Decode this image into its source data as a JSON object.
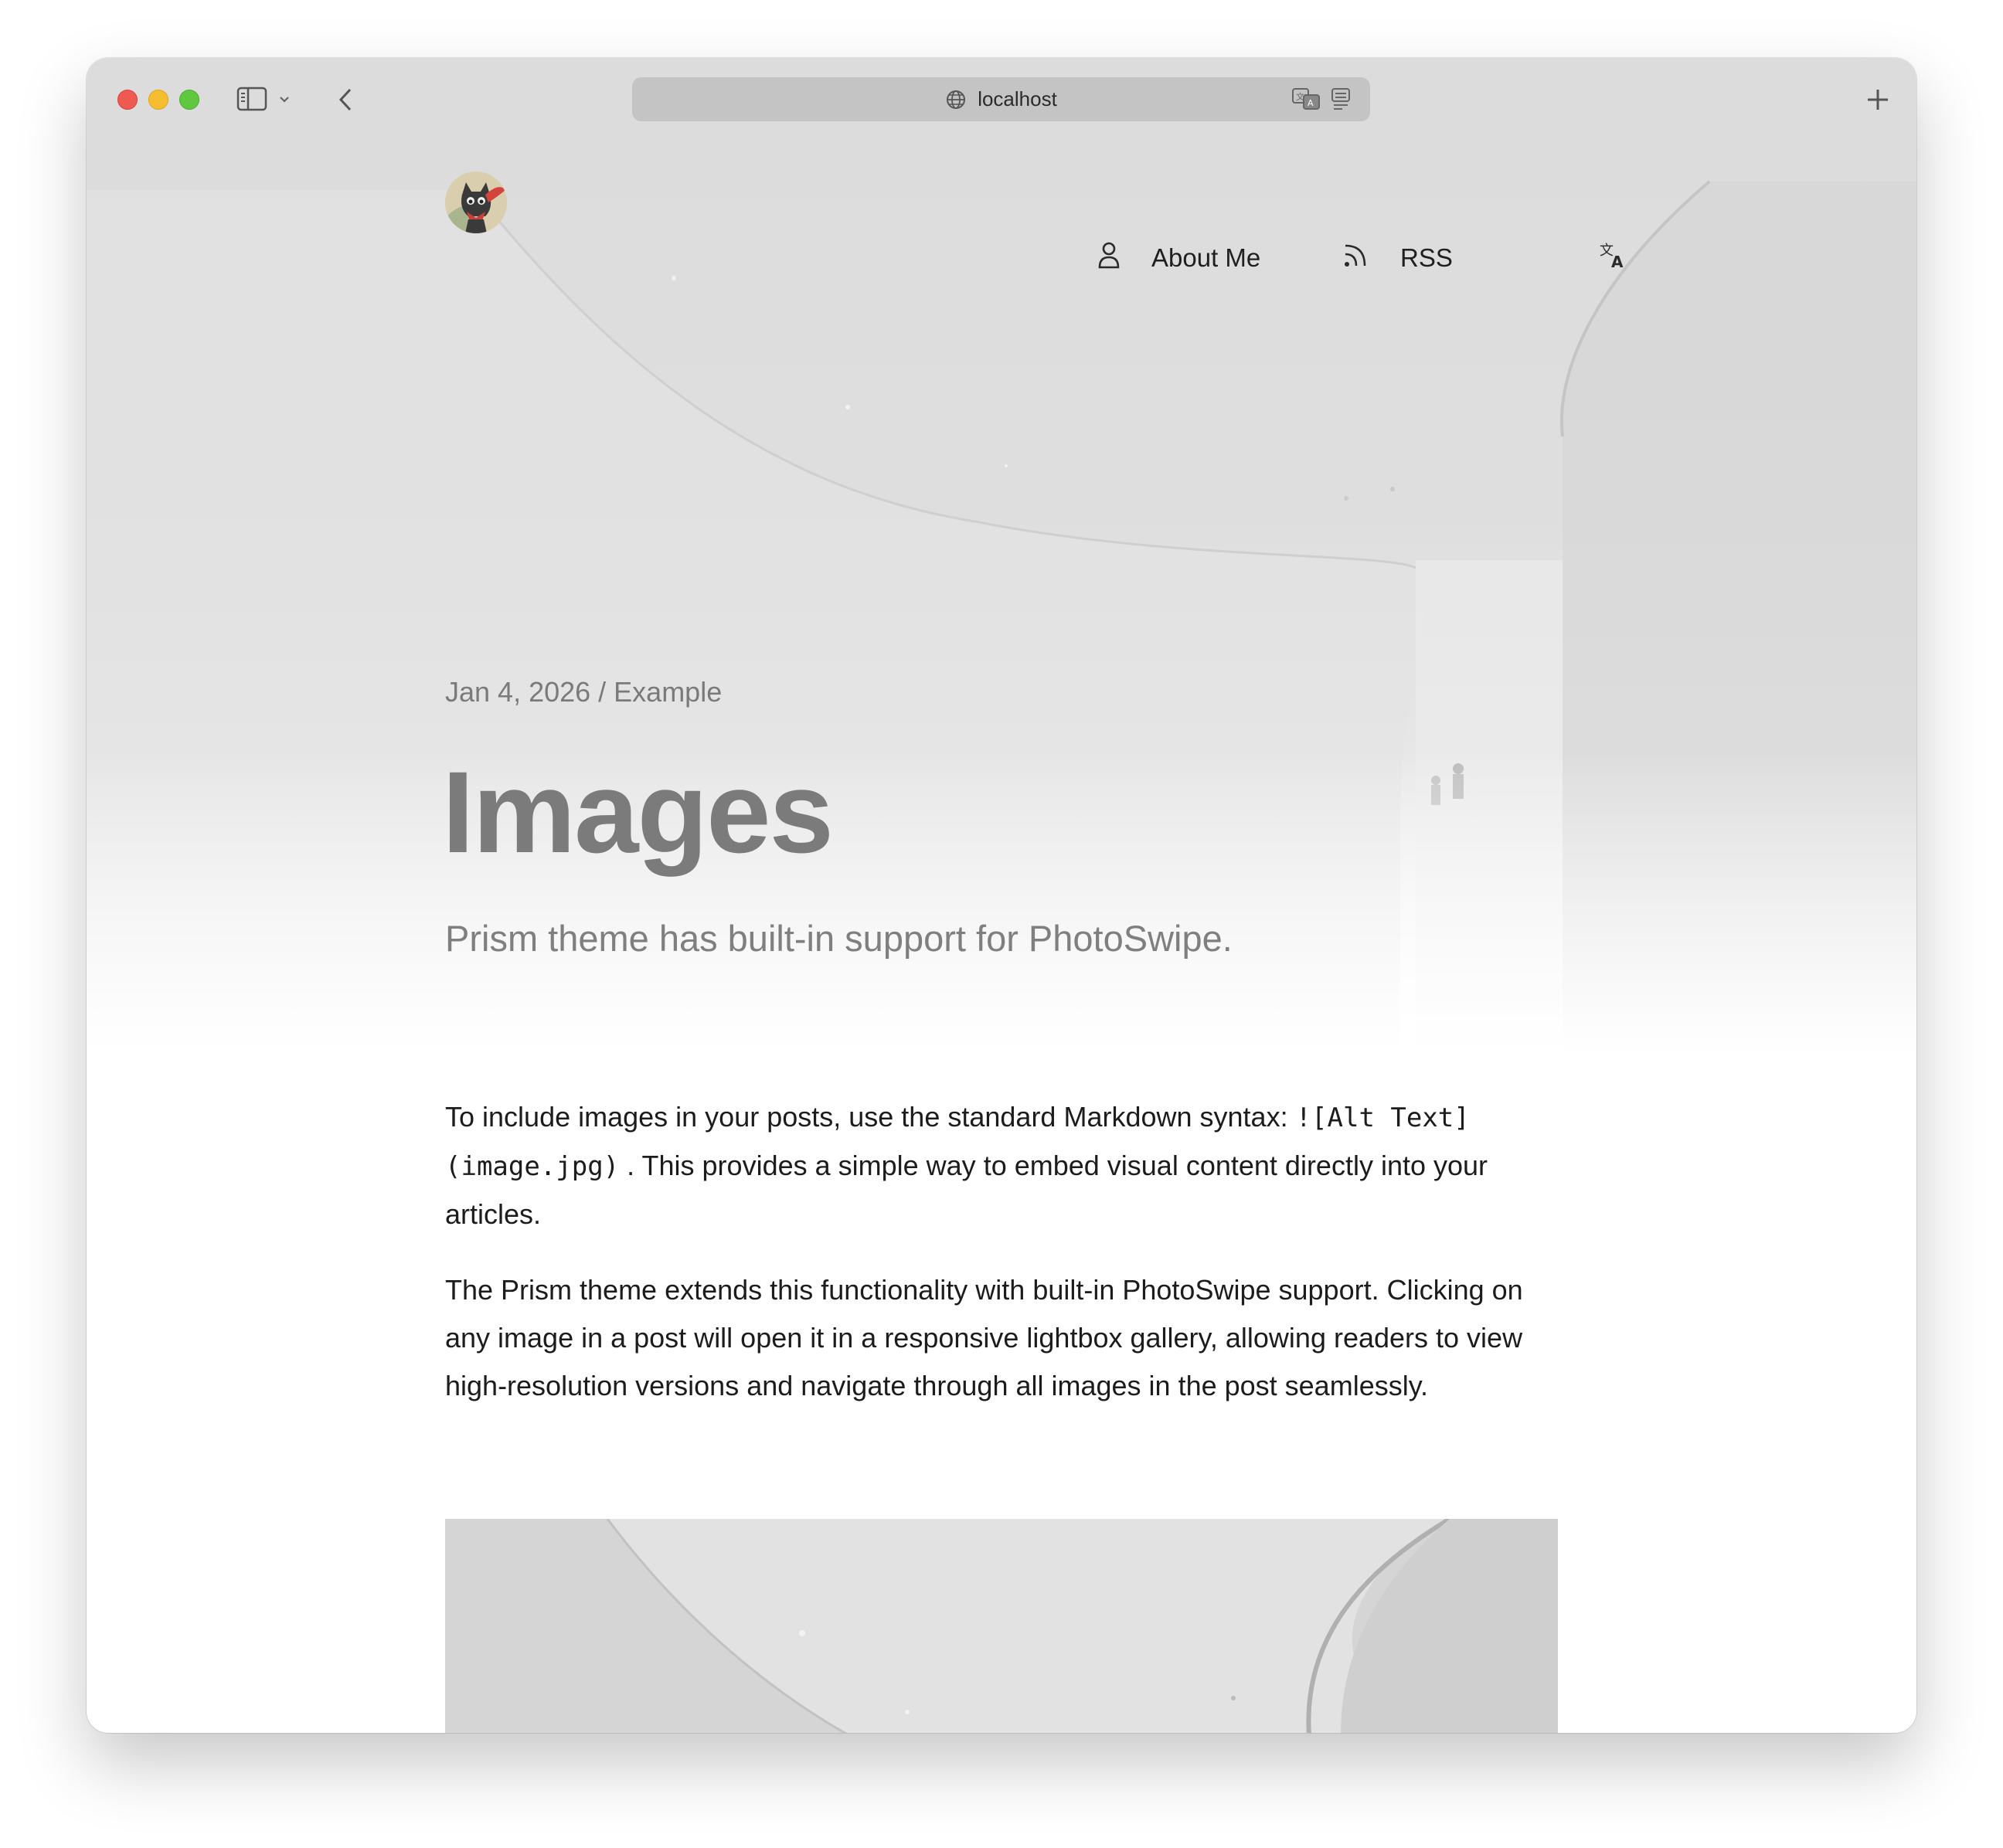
{
  "browser": {
    "url": "localhost"
  },
  "nav": {
    "about_label": "About Me",
    "rss_label": "RSS"
  },
  "post": {
    "meta": "Jan 4, 2026 / Example",
    "title": "Images",
    "subtitle": "Prism theme has built-in support for PhotoSwipe.",
    "p1_before": "To include images in your posts, use the standard Markdown syntax: ",
    "p1_code": "![Alt Text](image.jpg)",
    "p1_after": " . This provides a simple way to embed visual content directly into your articles.",
    "p2": "The Prism theme extends this functionality with built-in PhotoSwipe support. Clicking on any image in a post will open it in a responsive lightbox gallery, allowing readers to view high-resolution versions and navigate through all images in the post seamlessly."
  },
  "icons": {
    "sidebar": "sidebar-icon",
    "chevron": "chevron-down-icon",
    "back": "back-arrow-icon",
    "globe": "globe-icon",
    "translate": "translate-icon",
    "reader": "reader-icon",
    "new_tab": "plus-icon",
    "person": "person-icon",
    "rss": "rss-icon",
    "language": "language-icon"
  }
}
